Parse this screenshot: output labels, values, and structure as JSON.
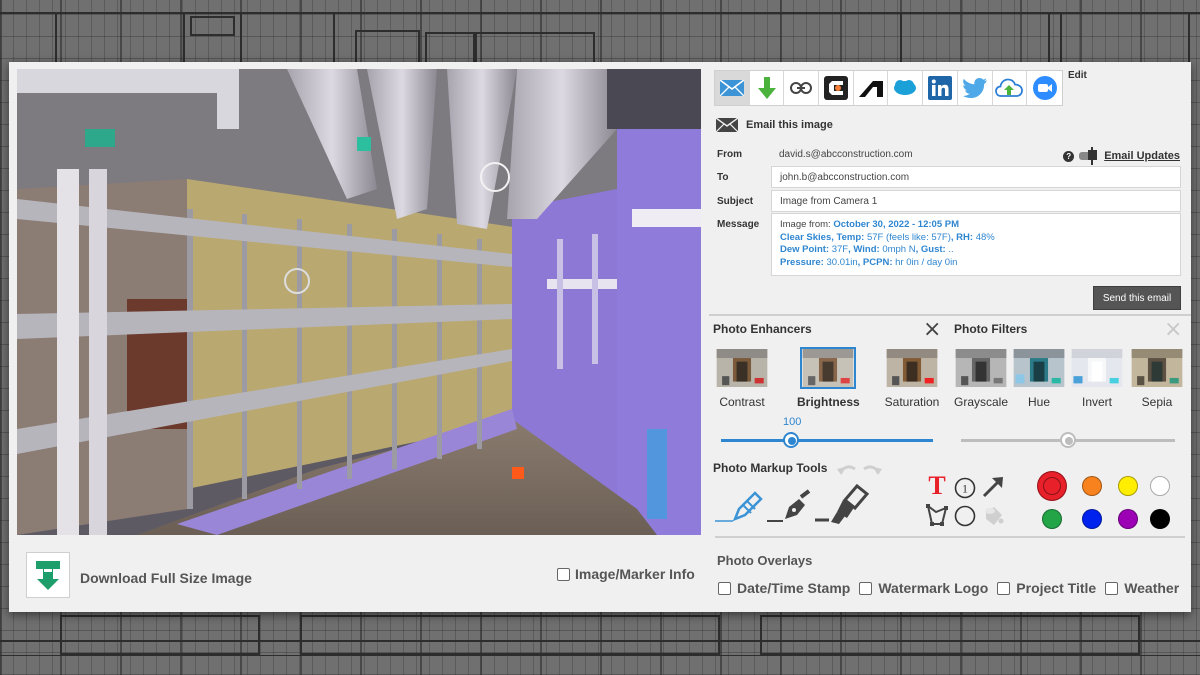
{
  "left": {
    "download_label": "Download Full Size Image",
    "marker_info_label": "Image/Marker Info",
    "marker_info_checked": false
  },
  "share": {
    "icons": [
      "email-icon",
      "download-icon",
      "link-icon",
      "procore-icon",
      "autodesk-icon",
      "salesforce-icon",
      "linkedin-icon",
      "twitter-icon",
      "cloud-upload-icon",
      "zoom-icon"
    ],
    "active": "email-icon",
    "edit_label": "Edit"
  },
  "email": {
    "title": "Email this image",
    "from_label": "From",
    "from_value": "david.s@abcconstruction.com",
    "updates_label": "Email Updates",
    "to_label": "To",
    "to_value": "john.b@abcconstruction.com",
    "subject_label": "Subject",
    "subject_value": "Image from Camera 1",
    "message_label": "Message",
    "message": {
      "image_from_label": "Image from:",
      "date": "October 30, 2022 - 12:05 PM",
      "conditions": "Clear Skies,",
      "temp_label": "Temp:",
      "temp_value": "57F (feels like: 57F)",
      "rh_label": ", RH:",
      "rh_value": "48%",
      "dew_label": "Dew Point:",
      "dew_value": "37F",
      "wind_label": ", Wind:",
      "wind_value": "0mph N",
      "gust_label": ", Gust:",
      "gust_value": "..",
      "pressure_label": "Pressure:",
      "pressure_value": "30.01in",
      "pcpn_label": ", PCPN:",
      "pcpn_value": "hr 0in / day 0in"
    },
    "send_label": "Send this email"
  },
  "enhancers": {
    "title": "Photo Enhancers",
    "items": [
      {
        "label": "Contrast",
        "selected": false
      },
      {
        "label": "Brightness",
        "selected": true
      },
      {
        "label": "Saturation",
        "selected": false
      }
    ],
    "slider_value": "100",
    "slider_fraction": 0.33,
    "accent": "#2f86d0"
  },
  "filters": {
    "title": "Photo Filters",
    "items": [
      {
        "label": "Grayscale"
      },
      {
        "label": "Hue"
      },
      {
        "label": "Invert"
      },
      {
        "label": "Sepia"
      }
    ],
    "slider_fraction": 0.5
  },
  "markup": {
    "title": "Photo Markup Tools",
    "tools": [
      "pencil-icon",
      "pen-icon",
      "highlighter-icon",
      "text-icon",
      "numbered-marker-icon",
      "arrow-icon",
      "polygon-icon",
      "circle-icon",
      "fill-bucket-icon"
    ],
    "colors": [
      "#e8202a",
      "#f7821e",
      "#ffee00",
      "#ffffff",
      "#22a447",
      "#0022ee",
      "#9b00b5",
      "#000000"
    ],
    "selected_color": "#e8202a"
  },
  "overlays": {
    "title": "Photo Overlays",
    "items": [
      {
        "label": "Date/Time Stamp",
        "checked": false
      },
      {
        "label": "Watermark Logo",
        "checked": false
      },
      {
        "label": "Project Title",
        "checked": false
      },
      {
        "label": "Weather",
        "checked": false
      }
    ]
  }
}
